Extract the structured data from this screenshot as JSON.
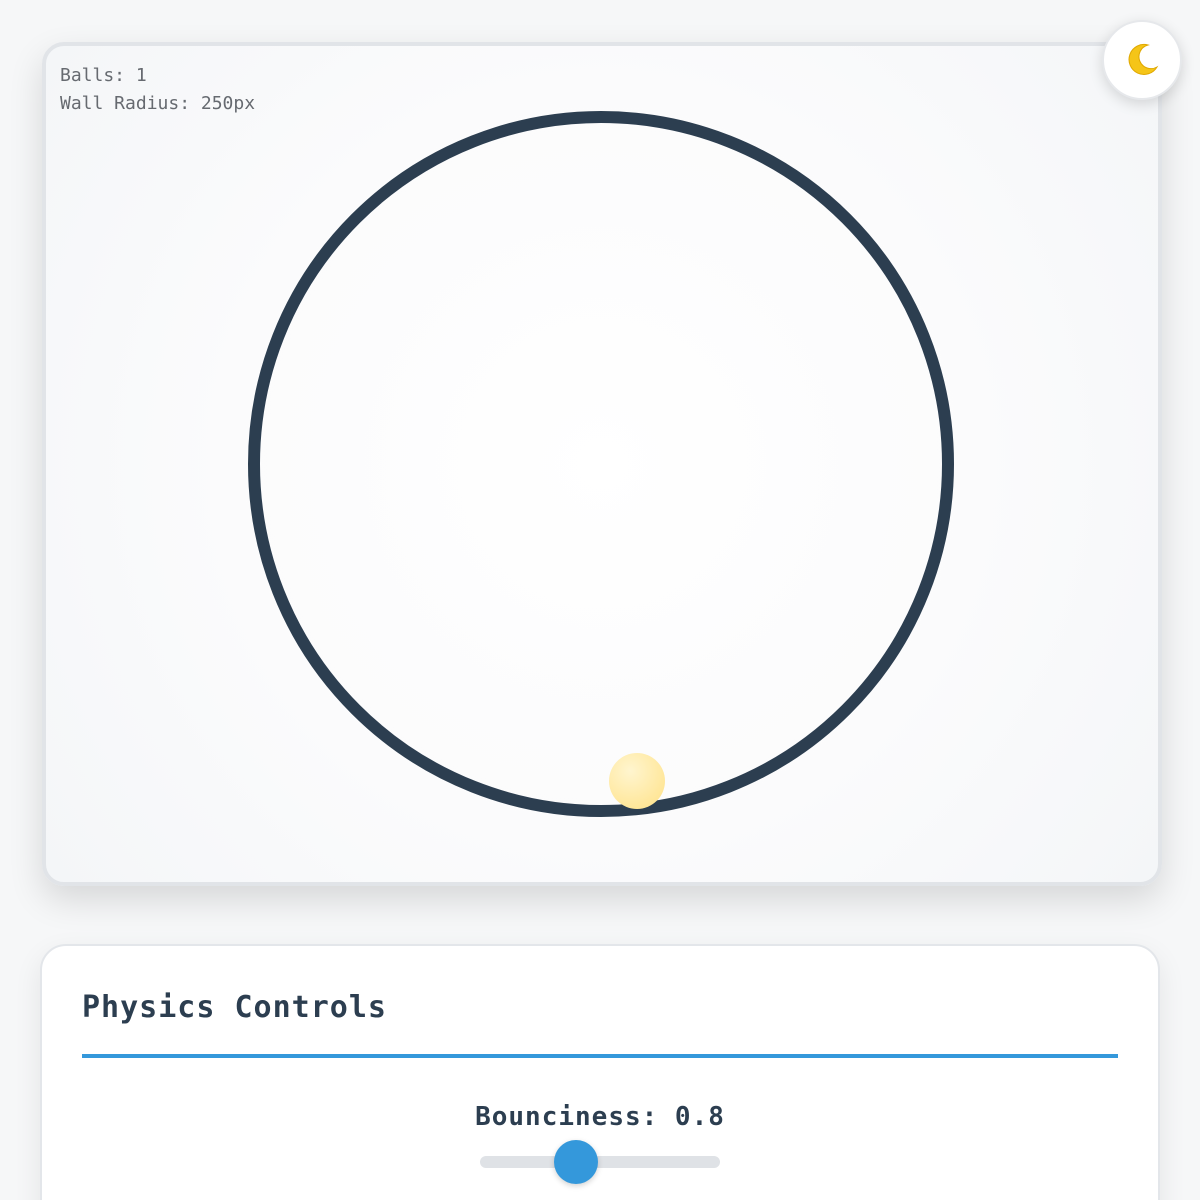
{
  "simulation": {
    "stats": {
      "balls_label": "Balls: 1",
      "wall_radius_label": "Wall Radius: 250px"
    },
    "wall_color": "#2c3e50",
    "ball_color": "#ffe9a0",
    "background_color": "#fafbfc"
  },
  "theme_toggle": {
    "icon": "moon-icon",
    "icon_color": "#f5c518"
  },
  "controls": {
    "title": "Physics Controls",
    "accent_color": "#3498db",
    "bounciness": {
      "label": "Bounciness: 0.8",
      "value": 0.8,
      "min": 0,
      "max": 2
    }
  }
}
